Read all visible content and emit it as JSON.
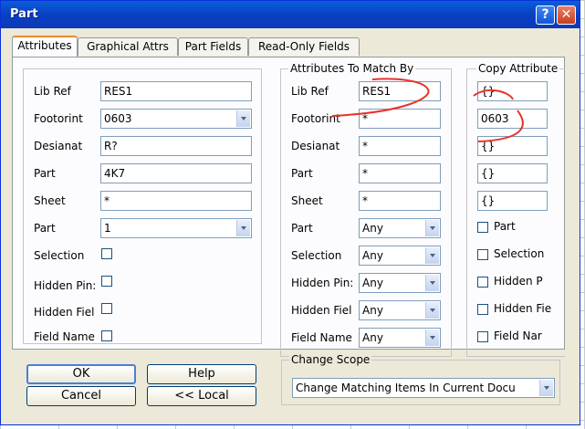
{
  "window": {
    "title": "Part",
    "help_glyph": "?",
    "close_glyph": "✕"
  },
  "tabs": [
    {
      "label": "Attributes",
      "active": true
    },
    {
      "label": "Graphical Attrs",
      "active": false
    },
    {
      "label": "Part Fields",
      "active": false
    },
    {
      "label": "Read-Only Fields",
      "active": false
    }
  ],
  "left": {
    "lib_ref": {
      "label": "Lib Ref",
      "value": "RES1"
    },
    "footprint": {
      "label": "Footorint",
      "value": "0603"
    },
    "designator": {
      "label": "Desianat",
      "value": "R?"
    },
    "part": {
      "label": "Part",
      "value": "4K7"
    },
    "sheet": {
      "label": "Sheet",
      "value": "*"
    },
    "part_num": {
      "label": "Part",
      "value": "1"
    },
    "selection": {
      "label": "Selection"
    },
    "hidden_pins": {
      "label": "Hidden Pin:"
    },
    "hidden_fields": {
      "label": "Hidden Fiel"
    },
    "field_names": {
      "label": "Field Name"
    }
  },
  "match": {
    "title": "Attributes To Match By",
    "lib_ref": {
      "label": "Lib Ref",
      "value": "RES1"
    },
    "footprint": {
      "label": "Footorint",
      "value": "*"
    },
    "designator": {
      "label": "Desianat",
      "value": "*"
    },
    "part": {
      "label": "Part",
      "value": "*"
    },
    "sheet": {
      "label": "Sheet",
      "value": "*"
    },
    "part_num": {
      "label": "Part",
      "value": "Any"
    },
    "selection": {
      "label": "Selection",
      "value": "Any"
    },
    "hidden_pins": {
      "label": "Hidden Pin:",
      "value": "Any"
    },
    "hidden_fields": {
      "label": "Hidden Fiel",
      "value": "Any"
    },
    "field_names": {
      "label": "Field Name",
      "value": "Any"
    }
  },
  "copy": {
    "title": "Copy Attribute",
    "lib_ref": "{}",
    "footprint": "0603",
    "designator": "{}",
    "part": "{}",
    "sheet": "{}",
    "part_label": "Part",
    "selection_label": "Selection",
    "hidden_pins_label": "Hidden P",
    "hidden_fields_label": "Hidden Fie",
    "field_names_label": "Field Nar"
  },
  "buttons": {
    "ok": "OK",
    "help": "Help",
    "cancel": "Cancel",
    "local": "<< Local"
  },
  "scope": {
    "title": "Change Scope",
    "value": "Change Matching Items In Current Docu"
  },
  "annotation_color": "#e8332a"
}
